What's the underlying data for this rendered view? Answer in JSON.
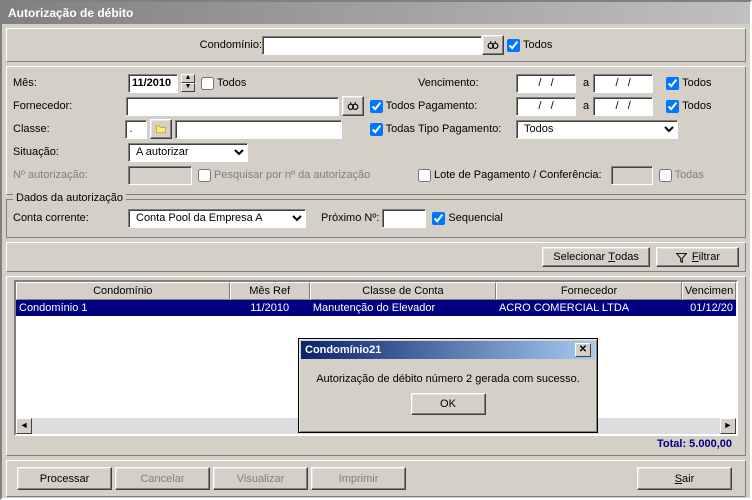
{
  "window": {
    "title": "Autorização de débito"
  },
  "top": {
    "condominio_label": "Condomínio:",
    "condominio_value": "",
    "todos1": "Todos"
  },
  "filters": {
    "mes_label": "Mês:",
    "mes_value": "11/2010",
    "mes_todos": "Todos",
    "fornecedor_label": "Fornecedor:",
    "fornecedor_value": "",
    "fornecedor_todos": "Todos",
    "classe_label": "Classe:",
    "classe_value": ".",
    "classe_text": "",
    "classe_todas": "Todas",
    "situacao_label": "Situação:",
    "situacao_value": "A autorizar",
    "nauth_label": "Nº autorização:",
    "nauth_value": "",
    "nauth_search": "Pesquisar por nº da autorização",
    "venc_label": "Vencimento:",
    "date_ph": "/   /",
    "a": "a",
    "venc_todos": "Todos",
    "pag_label": "Pagamento:",
    "pag_todos": "Todos",
    "tipopag_label": "Tipo Pagamento:",
    "tipopag_value": "Todos",
    "lote_label": "Lote de Pagamento / Conferência:",
    "lote_value": "",
    "lote_todas": "Todas"
  },
  "auth": {
    "legend": "Dados da autorização",
    "cc_label": "Conta corrente:",
    "cc_value": "Conta Pool da Empresa A",
    "prox_label": "Próximo Nº:",
    "prox_value": "",
    "seq": "Sequencial"
  },
  "actions": {
    "selecionar": "Selecionar",
    "selecionar_accel": "T",
    "selecionar_suffix": "odas",
    "filtrar": "Filtrar",
    "filtrar_accel": "F"
  },
  "grid": {
    "headers": [
      "Condomínio",
      "Mês Ref",
      "Classe de Conta",
      "Fornecedor",
      "Vencimen"
    ],
    "rows": [
      {
        "condominio": "Condomínio 1",
        "mes": "11/2010",
        "classe": "Manutenção do Elevador",
        "fornecedor": "ACRO COMERCIAL LTDA",
        "venc": "01/12/20"
      }
    ]
  },
  "total": {
    "label": "Total:",
    "value": "5.000,00"
  },
  "buttons": {
    "processar": "Processar",
    "cancelar": "Cancelar",
    "visualizar": "Visualizar",
    "imprimir": "Imprimir",
    "sair": "Sair",
    "sair_accel": "S"
  },
  "dialog": {
    "title": "Condomínio21",
    "message": "Autorização de débito número 2 gerada com sucesso.",
    "ok": "OK"
  }
}
